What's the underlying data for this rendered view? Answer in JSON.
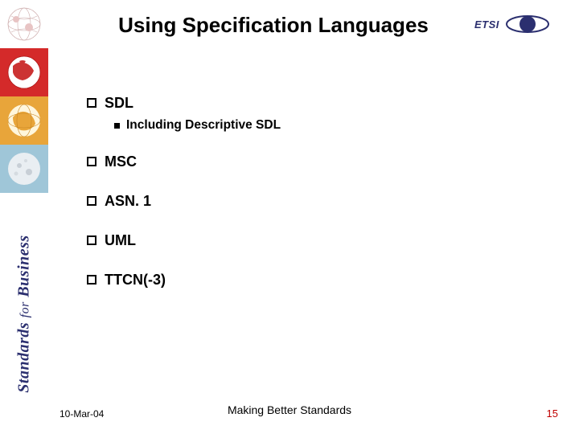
{
  "title": "Using Specification Languages",
  "logo": {
    "text": "ETSI"
  },
  "vertical_label": {
    "word1": "Standards",
    "word2": "for",
    "word3": "Business"
  },
  "strip_icons": [
    "globe-sketch-icon",
    "globe-red-icon",
    "globe-orange-icon",
    "moon-icon"
  ],
  "bullets": [
    {
      "text": "SDL",
      "sub": [
        {
          "text": "Including Descriptive SDL"
        }
      ]
    },
    {
      "text": "MSC"
    },
    {
      "text": "ASN. 1"
    },
    {
      "text": "UML"
    },
    {
      "text": "TTCN(-3)"
    }
  ],
  "footer": {
    "date": "10-Mar-04",
    "center": "Making Better Standards",
    "page": "15"
  },
  "colors": {
    "accent_red": "#c00000",
    "brand_navy": "#2b2f6f"
  }
}
